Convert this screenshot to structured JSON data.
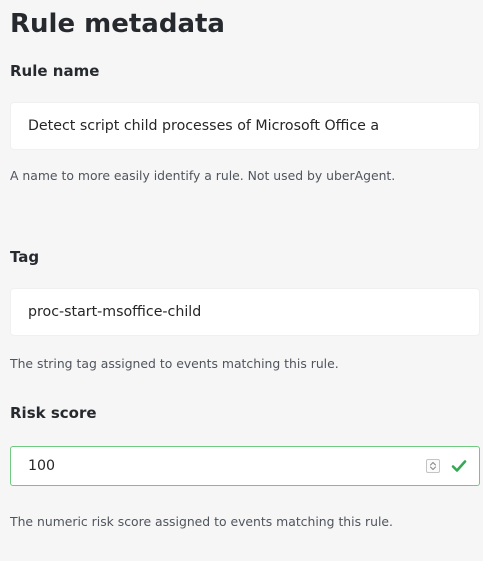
{
  "section": {
    "title": "Rule metadata"
  },
  "rule_name": {
    "label": "Rule name",
    "value": "Detect script child processes of Microsoft Office a",
    "help": "A name to more easily identify a rule. Not used by uberAgent."
  },
  "tag": {
    "label": "Tag",
    "value": "proc-start-msoffice-child",
    "help": "The string tag assigned to events matching this rule."
  },
  "risk_score": {
    "label": "Risk score",
    "value": "100",
    "help": "The numeric risk score assigned to events matching this rule."
  },
  "colors": {
    "valid_border": "#6fc97f",
    "check": "#34a853",
    "page_background": "#f6f6f7",
    "input_background": "#ffffff"
  },
  "icons": {
    "stepper": "spinner-arrows-icon",
    "valid": "checkmark-icon"
  }
}
